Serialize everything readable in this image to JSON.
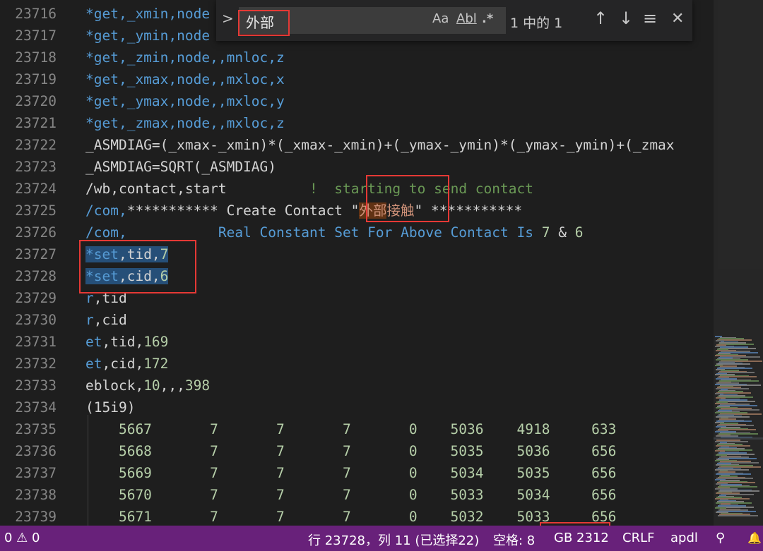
{
  "editor": {
    "lines": [
      {
        "num": "23716",
        "parts": [
          {
            "t": "*get,_xmin,node",
            "c": "kw"
          }
        ]
      },
      {
        "num": "23717",
        "parts": [
          {
            "t": "*get,_ymin,node",
            "c": "kw"
          }
        ]
      },
      {
        "num": "23718",
        "parts": [
          {
            "t": "*get,_zmin,node,,mnloc,z",
            "c": "kw"
          }
        ]
      },
      {
        "num": "23719",
        "parts": [
          {
            "t": "*get,_xmax,node,,mxloc,x",
            "c": "kw"
          }
        ]
      },
      {
        "num": "23720",
        "parts": [
          {
            "t": "*get,_ymax,node,,mxloc,y",
            "c": "kw"
          }
        ]
      },
      {
        "num": "23721",
        "parts": [
          {
            "t": "*get,_zmax,node,,mxloc,z",
            "c": "kw"
          }
        ]
      },
      {
        "num": "23722",
        "parts": [
          {
            "t": "_ASMDIAG=(_xmax-_xmin)*(_xmax-_xmin)+(_ymax-_ymin)*(_ymax-_ymin)+(_zmax",
            "c": ""
          }
        ]
      },
      {
        "num": "23723",
        "parts": [
          {
            "t": "_ASMDIAG=SQRT(_ASMDIAG)",
            "c": ""
          }
        ]
      },
      {
        "num": "23724",
        "parts": [
          {
            "t": "/wb,contact,start",
            "c": ""
          },
          {
            "t": "          !  starting to send contact",
            "c": "cm"
          }
        ]
      },
      {
        "num": "23725",
        "parts": [
          {
            "t": "/com,",
            "c": "kw"
          },
          {
            "t": "*********** Create Contact \"",
            "c": ""
          },
          {
            "t": "外部",
            "c": "hl"
          },
          {
            "t": "接触",
            "c": "st"
          },
          {
            "t": "\" ***********",
            "c": ""
          }
        ]
      },
      {
        "num": "23726",
        "parts": [
          {
            "t": "/com,",
            "c": "kw"
          },
          {
            "t": "           Real Constant Set For Above Contact Is ",
            "c": "kw"
          },
          {
            "t": "7",
            "c": "nm"
          },
          {
            "t": " & ",
            "c": ""
          },
          {
            "t": "6",
            "c": "nm"
          }
        ]
      },
      {
        "num": "23727",
        "parts": [
          {
            "t": "*set",
            "c": "kw sel"
          },
          {
            "t": ",tid,",
            "c": "sel"
          },
          {
            "t": "7",
            "c": "nm sel"
          }
        ]
      },
      {
        "num": "23728",
        "parts": [
          {
            "t": "*set",
            "c": "kw sel"
          },
          {
            "t": ",cid,",
            "c": "sel"
          },
          {
            "t": "6",
            "c": "nm sel"
          }
        ]
      },
      {
        "num": "23729",
        "parts": [
          {
            "t": "r",
            "c": "kw"
          },
          {
            "t": ",tid",
            "c": ""
          }
        ]
      },
      {
        "num": "23730",
        "parts": [
          {
            "t": "r",
            "c": "kw"
          },
          {
            "t": ",cid",
            "c": ""
          }
        ]
      },
      {
        "num": "23731",
        "parts": [
          {
            "t": "et",
            "c": "kw"
          },
          {
            "t": ",tid,",
            "c": ""
          },
          {
            "t": "169",
            "c": "nm"
          }
        ]
      },
      {
        "num": "23732",
        "parts": [
          {
            "t": "et",
            "c": "kw"
          },
          {
            "t": ",cid,",
            "c": ""
          },
          {
            "t": "172",
            "c": "nm"
          }
        ]
      },
      {
        "num": "23733",
        "parts": [
          {
            "t": "eblock,",
            "c": ""
          },
          {
            "t": "10",
            "c": "nm"
          },
          {
            "t": ",,,",
            "c": ""
          },
          {
            "t": "398",
            "c": "nm"
          }
        ]
      },
      {
        "num": "23734",
        "parts": [
          {
            "t": "(15i9)",
            "c": ""
          }
        ]
      },
      {
        "num": "23735",
        "parts": [
          {
            "t": "    5667",
            "c": "nm"
          },
          {
            "t": "       7       7       7       0    5036    4918     633",
            "c": "nm"
          }
        ]
      },
      {
        "num": "23736",
        "parts": [
          {
            "t": "    5668",
            "c": "nm"
          },
          {
            "t": "       7       7       7       0    5035    5036     656",
            "c": "nm"
          }
        ]
      },
      {
        "num": "23737",
        "parts": [
          {
            "t": "    5669",
            "c": "nm"
          },
          {
            "t": "       7       7       7       0    5034    5035     656",
            "c": "nm"
          }
        ]
      },
      {
        "num": "23738",
        "parts": [
          {
            "t": "    5670",
            "c": "nm"
          },
          {
            "t": "       7       7       7       0    5033    5034     656",
            "c": "nm"
          }
        ]
      },
      {
        "num": "23739",
        "parts": [
          {
            "t": "    5671",
            "c": "nm"
          },
          {
            "t": "       7       7       7       0    5032    5033     656",
            "c": "nm"
          }
        ]
      }
    ]
  },
  "find": {
    "toggle_icon": "chevron-right-icon",
    "toggle_glyph": ">",
    "query": "外部",
    "match_case": "Aa",
    "whole_word": "Abl",
    "regex": ".*",
    "result": "1 中的 1",
    "prev_glyph": "↑",
    "next_glyph": "↓",
    "selection_glyph": "≡",
    "close_glyph": "✕"
  },
  "status": {
    "problems": "0 ⚠ 0",
    "position": "行 23728，列 11 (已选择22)",
    "indent": "空格: 8",
    "encoding": "GB 2312",
    "eol": "CRLF",
    "language": "apdl",
    "feedback_glyph": "⚲",
    "bell_glyph": "🔔"
  },
  "colors": {
    "status_bar": "#68217a",
    "editor_bg": "#1e1e1e",
    "keyword": "#569cd6",
    "comment": "#6a9955",
    "number": "#b5cea8",
    "string": "#ce9178",
    "selection": "#264f78",
    "annotation_box": "#e53935"
  }
}
